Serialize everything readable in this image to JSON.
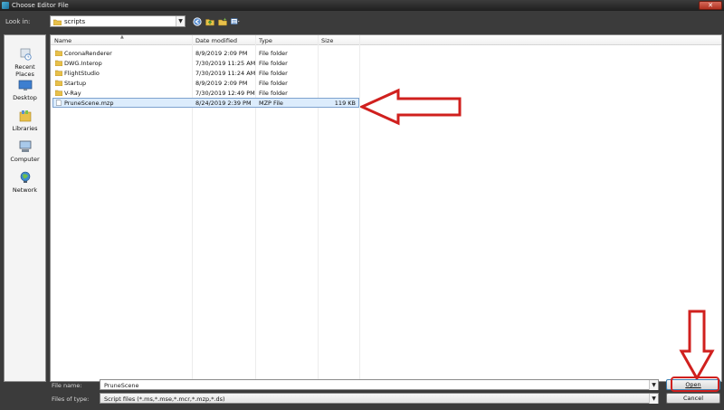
{
  "window": {
    "title": "Choose Editor File",
    "close_label": "✕"
  },
  "lookin": {
    "label": "Look in:",
    "value": "scripts"
  },
  "toolbar": {
    "icons": [
      "back-icon",
      "up-folder-icon",
      "new-folder-icon",
      "view-menu-icon"
    ]
  },
  "places": [
    {
      "name": "recent-places",
      "label": "Recent Places",
      "icon": "recent-places-icon"
    },
    {
      "name": "desktop",
      "label": "Desktop",
      "icon": "desktop-icon"
    },
    {
      "name": "libraries",
      "label": "Libraries",
      "icon": "libraries-icon"
    },
    {
      "name": "computer",
      "label": "Computer",
      "icon": "computer-icon"
    },
    {
      "name": "network",
      "label": "Network",
      "icon": "network-icon"
    }
  ],
  "columns": {
    "name": "Name",
    "date": "Date modified",
    "type": "Type",
    "size": "Size"
  },
  "files": [
    {
      "name": "CoronaRenderer",
      "date": "8/9/2019 2:09 PM",
      "type": "File folder",
      "size": "",
      "kind": "folder"
    },
    {
      "name": "DWG.Interop",
      "date": "7/30/2019 11:25 AM",
      "type": "File folder",
      "size": "",
      "kind": "folder"
    },
    {
      "name": "FlightStudio",
      "date": "7/30/2019 11:24 AM",
      "type": "File folder",
      "size": "",
      "kind": "folder"
    },
    {
      "name": "Startup",
      "date": "8/9/2019 2:09 PM",
      "type": "File folder",
      "size": "",
      "kind": "folder"
    },
    {
      "name": "V-Ray",
      "date": "7/30/2019 12:49 PM",
      "type": "File folder",
      "size": "",
      "kind": "folder"
    },
    {
      "name": "PruneScene.mzp",
      "date": "8/24/2019 2:39 PM",
      "type": "MZP File",
      "size": "119 KB",
      "kind": "file",
      "selected": true
    }
  ],
  "bottom": {
    "filename_label": "File name:",
    "filename_value": "PruneScene",
    "filetype_label": "Files of type:",
    "filetype_value": "Script files (*.ms,*.mse,*.mcr,*.mzp,*.ds)",
    "open_label": "Open",
    "cancel_label": "Cancel"
  },
  "colors": {
    "annotation": "#d0201e",
    "selection": "#dcecfc",
    "folder": "#e8c04a"
  }
}
